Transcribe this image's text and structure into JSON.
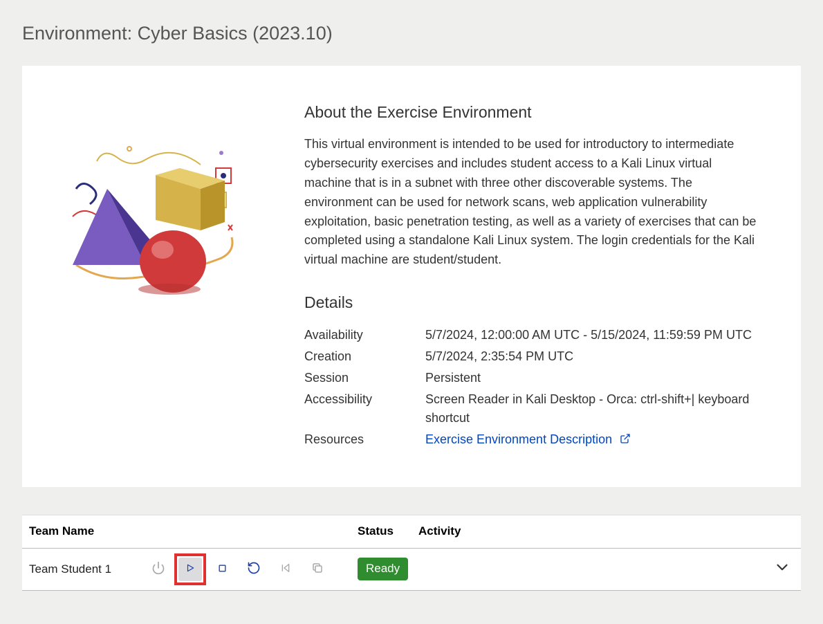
{
  "page": {
    "title": "Environment: Cyber Basics (2023.10)"
  },
  "about": {
    "heading": "About the Exercise Environment",
    "text": "This virtual environment is intended to be used for introductory to intermediate cybersecurity exercises and includes student access to a Kali Linux virtual machine that is in a subnet with three other discoverable systems. The environment can be used for network scans, web application vulnerability exploitation, basic penetration testing, as well as a variety of exercises that can be completed using a standalone Kali Linux system. The login credentials for the Kali virtual machine are student/student."
  },
  "details": {
    "heading": "Details",
    "rows": {
      "availability": {
        "label": "Availability",
        "value": "5/7/2024, 12:00:00 AM UTC - 5/15/2024, 11:59:59 PM UTC"
      },
      "creation": {
        "label": "Creation",
        "value": "5/7/2024, 2:35:54 PM UTC"
      },
      "session": {
        "label": "Session",
        "value": "Persistent"
      },
      "accessibility": {
        "label": "Accessibility",
        "value": "Screen Reader in Kali Desktop - Orca: ctrl-shift+| keyboard shortcut"
      },
      "resources": {
        "label": "Resources",
        "link_text": "Exercise Environment Description"
      }
    }
  },
  "teams": {
    "headers": {
      "name": "Team Name",
      "status": "Status",
      "activity": "Activity"
    },
    "rows": [
      {
        "name": "Team Student 1",
        "status": "Ready",
        "activity": ""
      }
    ]
  },
  "icons": {
    "power": "power-icon",
    "play": "play-icon",
    "stop": "stop-icon",
    "restart": "restart-icon",
    "previous": "skip-back-icon",
    "copy": "copy-icon",
    "expand": "chevron-down-icon",
    "external": "external-link-icon"
  },
  "colors": {
    "link": "#0046c2",
    "badge_bg": "#2f8c2f",
    "highlight_outline": "#e03030"
  }
}
